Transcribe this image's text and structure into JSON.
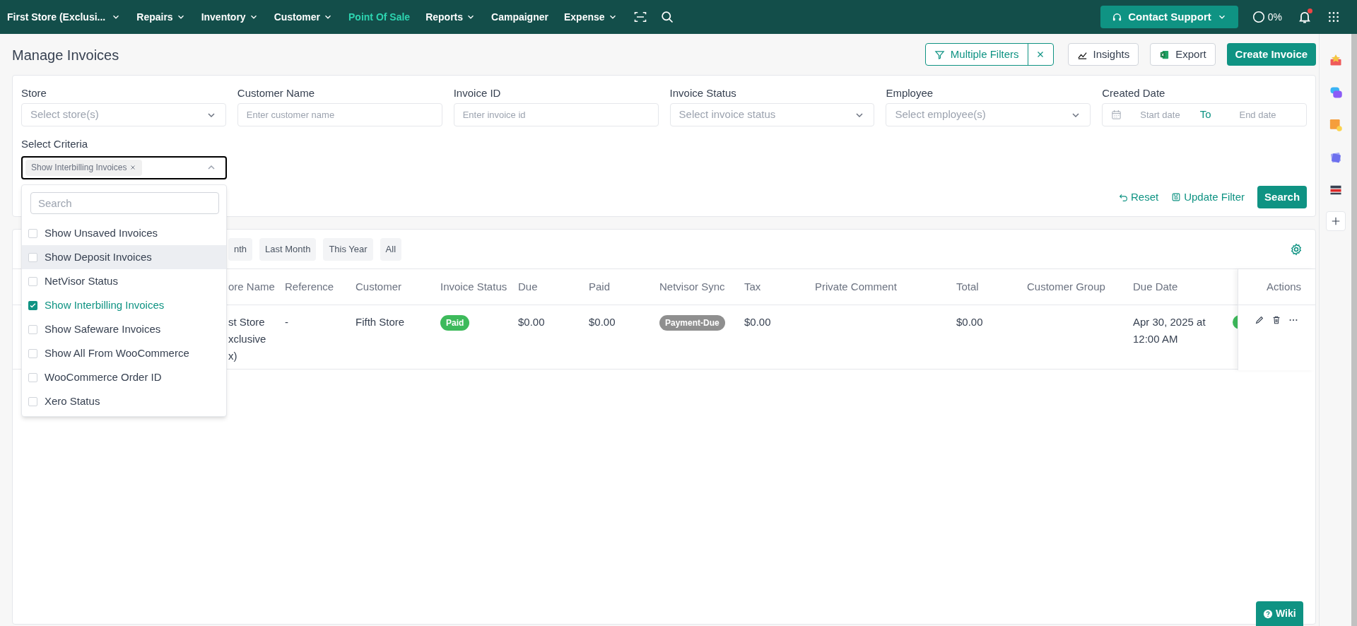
{
  "nav": {
    "store": "First Store (Exclusi...",
    "items": [
      {
        "label": "Repairs",
        "dropdown": true,
        "selected": false
      },
      {
        "label": "Inventory",
        "dropdown": true,
        "selected": false
      },
      {
        "label": "Customer",
        "dropdown": true,
        "selected": false
      },
      {
        "label": "Point Of Sale",
        "dropdown": false,
        "selected": true
      },
      {
        "label": "Reports",
        "dropdown": true,
        "selected": false
      },
      {
        "label": "Campaigner",
        "dropdown": false,
        "selected": false
      },
      {
        "label": "Expense",
        "dropdown": true,
        "selected": false
      }
    ],
    "support": "Contact Support",
    "progress": "0%",
    "notification_dot": true
  },
  "page": {
    "title": "Manage Invoices",
    "multiple_filters": "Multiple Filters",
    "insights": "Insights",
    "export": "Export",
    "create": "Create Invoice"
  },
  "filters": {
    "fields": [
      {
        "label": "Store",
        "placeholder": "Select store(s)",
        "kind": "select"
      },
      {
        "label": "Customer Name",
        "placeholder": "Enter customer name",
        "kind": "input"
      },
      {
        "label": "Invoice ID",
        "placeholder": "Enter invoice id",
        "kind": "input"
      },
      {
        "label": "Invoice Status",
        "placeholder": "Select invoice status",
        "kind": "select"
      },
      {
        "label": "Employee",
        "placeholder": "Select employee(s)",
        "kind": "select"
      },
      {
        "label": "Created Date",
        "kind": "date",
        "start": "Start date",
        "to": "To",
        "end": "End date"
      }
    ],
    "criteria": {
      "label": "Select Criteria",
      "tag": "Show Interbilling Invoices",
      "expanded": true
    },
    "reset": "Reset",
    "update": "Update Filter",
    "search": "Search"
  },
  "criteria_menu": {
    "search_placeholder": "Search",
    "options": [
      {
        "label": "Show Unsaved Invoices",
        "checked": false,
        "highlighted": false
      },
      {
        "label": "Show Deposit Invoices",
        "checked": false,
        "highlighted": true
      },
      {
        "label": "NetVisor Status",
        "checked": false,
        "highlighted": false
      },
      {
        "label": "Show Interbilling Invoices",
        "checked": true,
        "highlighted": false
      },
      {
        "label": "Show Safeware Invoices",
        "checked": false,
        "highlighted": false
      },
      {
        "label": "Show All From WooCommerce",
        "checked": false,
        "highlighted": false
      },
      {
        "label": "WooCommerce Order ID",
        "checked": false,
        "highlighted": false
      },
      {
        "label": "Xero Status",
        "checked": false,
        "highlighted": false
      }
    ]
  },
  "quick_filters": [
    {
      "label": "nth",
      "selected": false
    },
    {
      "label": "Last Month",
      "selected": false
    },
    {
      "label": "This Year",
      "selected": false
    },
    {
      "label": "All",
      "selected": false
    }
  ],
  "table": {
    "columns": [
      "ore Name",
      "Reference",
      "Customer",
      "Invoice Status",
      "Due",
      "Paid",
      "Netvisor Sync",
      "Tax",
      "Private Comment",
      "Total",
      "Customer Group",
      "Due Date"
    ],
    "actions_header": "Actions",
    "rows": [
      {
        "cells": [
          {
            "kind": "text",
            "text": "st Store\nxclusive\nx)"
          },
          {
            "kind": "text",
            "text": "-"
          },
          {
            "kind": "text",
            "text": "Fifth Store"
          },
          {
            "kind": "badge",
            "text": "Paid",
            "color": "#3dba5b"
          },
          {
            "kind": "text",
            "text": "$0.00"
          },
          {
            "kind": "text",
            "text": "$0.00"
          },
          {
            "kind": "badge",
            "text": "Payment-Due",
            "color": "#8f8f8f"
          },
          {
            "kind": "text",
            "text": "$0.00"
          },
          {
            "kind": "text",
            "text": ""
          },
          {
            "kind": "text",
            "text": "$0.00"
          },
          {
            "kind": "text",
            "text": ""
          },
          {
            "kind": "text",
            "text": "Apr 30, 2025 at\n12:00 AM"
          },
          {
            "kind": "dot",
            "color": "#3dba5b"
          }
        ]
      }
    ]
  },
  "wiki": "Wiki"
}
